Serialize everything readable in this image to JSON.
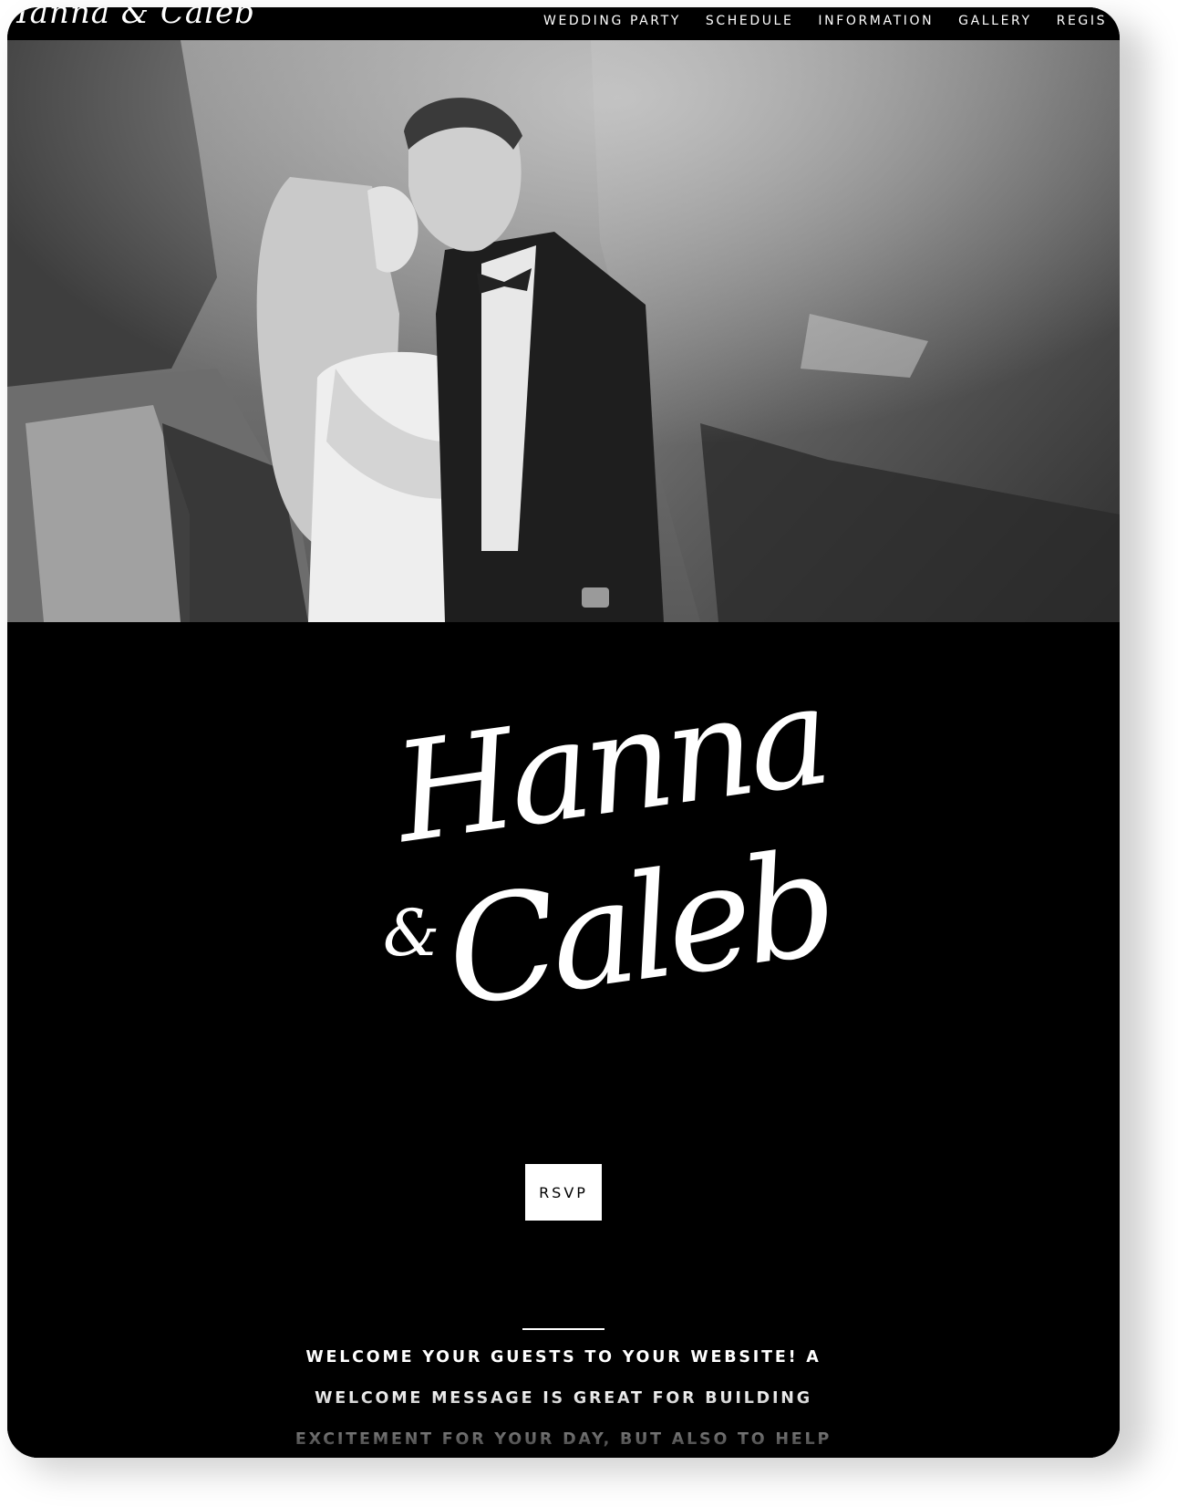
{
  "site": {
    "logo_text": "Hanna & Caleb",
    "nav": [
      "WEDDING PARTY",
      "SCHEDULE",
      "INFORMATION",
      "GALLERY",
      "REGIS"
    ]
  },
  "hero": {
    "photo_alt": "couple-kissing-mountain-photo"
  },
  "couple": {
    "name1": "Hanna",
    "ampersand": "&",
    "name2": "Caleb"
  },
  "rsvp_label": "RSVP",
  "welcome_text": "WELCOME YOUR GUESTS TO YOUR WEBSITE! A WELCOME MESSAGE IS GREAT FOR BUILDING EXCITEMENT FOR YOUR DAY, BUT ALSO TO HELP THEM NAVIGATE THEIR WAY AROUND YOUR WEDDING WEBSITE. WE ALSO RECOMMEND",
  "colors": {
    "background": "#000000",
    "text": "#ffffff",
    "button_bg": "#ffffff",
    "button_text": "#000000"
  }
}
